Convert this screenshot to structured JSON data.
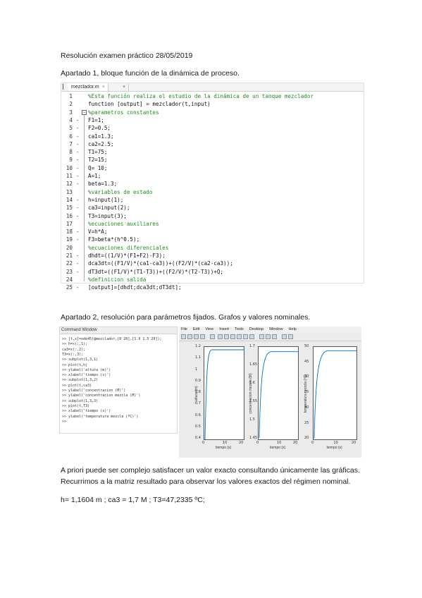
{
  "document": {
    "heading": "Resolución examen práctico 28/05/2019",
    "section1": "Apartado 1, bloque función de la dinámica de proceso.",
    "section2": "Apartado 2, resolución para parámetros fijados. Grafos y valores nominales.",
    "para1": "A priori puede ser complejo satisfacer un valor exacto consultando únicamente las gráficas.",
    "para2": "Recurrimos a la matriz resultado para observar los valores exactos del régimen nominal.",
    "result": "h= 1,1604 m ; ca3 = 1,7 M ; T3=47,2335 ºC;"
  },
  "editor": {
    "tab_label": "mezclador.m",
    "tab_close": "×",
    "tab_add": "+",
    "lines": [
      {
        "num": "1",
        "dash": "",
        "text": "%Esta función realiza el estudio de la dinámica de un tanque mezclador",
        "comment": true
      },
      {
        "num": "2",
        "dash": "",
        "text": "function [output] = mezclador(t,input)",
        "comment": false
      },
      {
        "num": "3",
        "dash": "",
        "text": "%parametros constantes",
        "comment": true
      },
      {
        "num": "4",
        "dash": "-",
        "text": "F1=1;",
        "comment": false
      },
      {
        "num": "5",
        "dash": "-",
        "text": "F2=0.5;",
        "comment": false
      },
      {
        "num": "6",
        "dash": "-",
        "text": "ca1=1.3;",
        "comment": false
      },
      {
        "num": "7",
        "dash": "-",
        "text": "ca2=2.5;",
        "comment": false
      },
      {
        "num": "8",
        "dash": "-",
        "text": "T1=75;",
        "comment": false
      },
      {
        "num": "9",
        "dash": "-",
        "text": "T2=15;",
        "comment": false
      },
      {
        "num": "10",
        "dash": "-",
        "text": "Q= 10;",
        "comment": false
      },
      {
        "num": "11",
        "dash": "-",
        "text": "A=1;",
        "comment": false
      },
      {
        "num": "12",
        "dash": "-",
        "text": "beta=1.3;",
        "comment": false
      },
      {
        "num": "13",
        "dash": "",
        "text": "%variables de estado",
        "comment": true
      },
      {
        "num": "14",
        "dash": "-",
        "text": "h=input(1);",
        "comment": false
      },
      {
        "num": "15",
        "dash": "-",
        "text": "ca3=input(2);",
        "comment": false
      },
      {
        "num": "16",
        "dash": "-",
        "text": "T3=input(3);",
        "comment": false
      },
      {
        "num": "17",
        "dash": "",
        "text": "%ecuaciones auxiliares",
        "comment": true
      },
      {
        "num": "18",
        "dash": "-",
        "text": "V=h*A;",
        "comment": false
      },
      {
        "num": "19",
        "dash": "-",
        "text": "F3=beta*(h^0.5);",
        "comment": false
      },
      {
        "num": "20",
        "dash": "",
        "text": "%ecuaciones diferenciales",
        "comment": true
      },
      {
        "num": "21",
        "dash": "-",
        "text": "dhdt=((1/V)*(F1+F2)-F3);",
        "comment": false
      },
      {
        "num": "22",
        "dash": "-",
        "text": "dca3dt=((F1/V)*(ca1-ca3))+((F2/V)*(ca2-ca3));",
        "comment": false
      },
      {
        "num": "23",
        "dash": "-",
        "text": "dT3dt=((F1/V)*(T1-T3))+((F2/V)*(T2-T3))+Q;",
        "comment": false
      },
      {
        "num": "24",
        "dash": "",
        "text": "%definicion salida",
        "comment": true
      },
      {
        "num": "25",
        "dash": "-",
        "text": "[output]=[dhdt;dca3dt;dT3dt];",
        "comment": false
      }
    ]
  },
  "command_window": {
    "title": "Command Window",
    "lines": [
      ">> [t,x]=ode45(@mezclador,[0 20],[1.0 1.5 20]);",
      ">> h=x(:,1);",
      "ca3=x(:,2);",
      "T3=x(:,3);",
      ">> subplot(1,3,1)",
      ">> plot(t,h)",
      ">> ylabel('altura (m)')",
      ">> xlabel('tiempo (s)')",
      ">> subplot(1,3,2)",
      ">> plot(t,ca3)",
      ">> ylabel('concentracion (M)')",
      ">> ylabel('concentracion mezcla (M)')",
      ">> subplot(1,3,3)",
      ">> plot(t,T3)",
      ">> xlabel('tiempo (s)')",
      ">> ylabel('temperatura mezcla (ºC)')",
      ">>"
    ]
  },
  "figure": {
    "menu": [
      "File",
      "Edit",
      "View",
      "Insert",
      "Tools",
      "Desktop",
      "Window",
      "Help"
    ],
    "plots": [
      {
        "ylabel": "altura (m)",
        "xlabel": "tiempo (s)",
        "yticks": [
          "1.2",
          "1.1",
          "1",
          "0.9",
          "0.8",
          "0.7",
          "0.6",
          "0.5",
          "0.4"
        ],
        "xticks": [
          "0",
          "10",
          "20"
        ]
      },
      {
        "ylabel": "concentracion mezcla (M)",
        "xlabel": "tiempo (s)",
        "yticks": [
          "1.7",
          "1.65",
          "1.6",
          "1.55",
          "1.5",
          "1.45"
        ],
        "xticks": [
          "0",
          "10",
          "20"
        ]
      },
      {
        "ylabel": "temperatura mezcla (ºC)",
        "xlabel": "tiempo (s)",
        "yticks": [
          "50",
          "45",
          "40",
          "35",
          "30",
          "25",
          "20"
        ],
        "xticks": [
          "0",
          "10",
          "20"
        ]
      }
    ],
    "line_color": "#0072bd"
  }
}
